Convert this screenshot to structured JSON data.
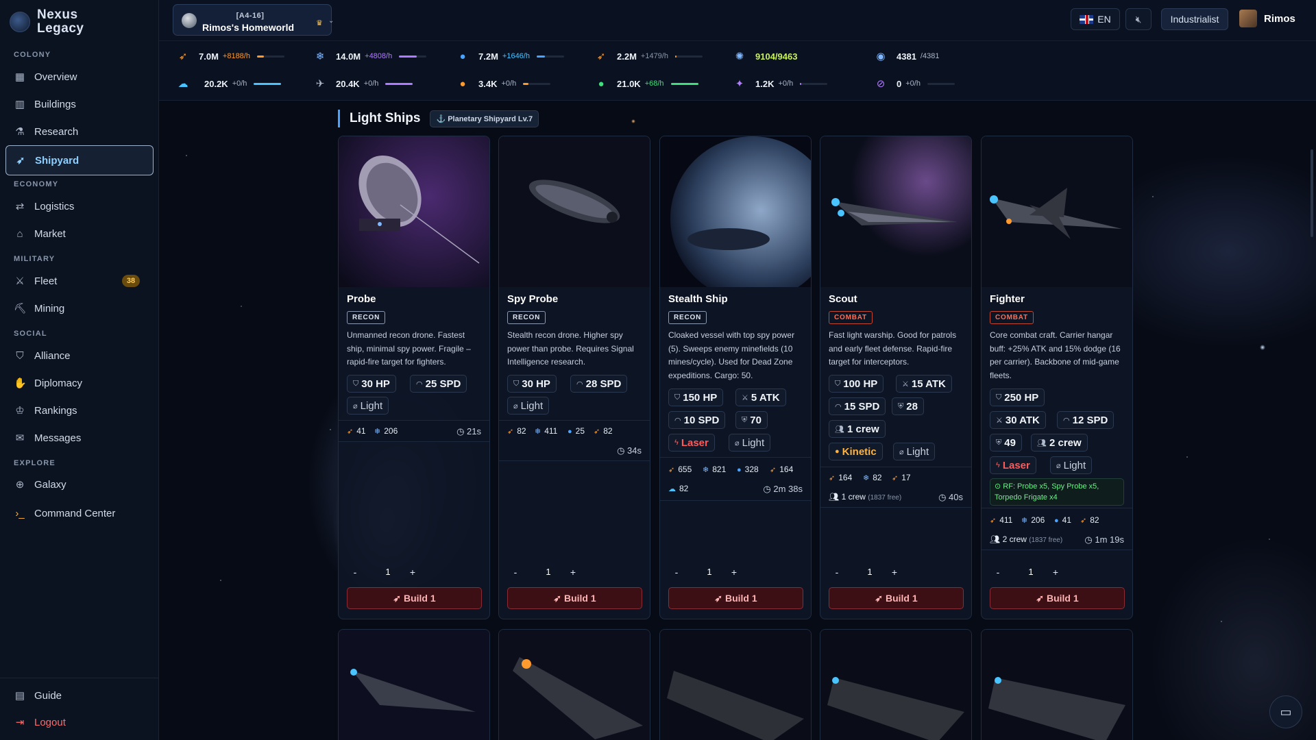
{
  "brand": {
    "name_line1": "Nexus",
    "name_line2": "Legacy"
  },
  "sidebar": {
    "sections": {
      "colony": "COLONY",
      "economy": "ECONOMY",
      "military": "MILITARY",
      "social": "SOCIAL",
      "explore": "EXPLORE"
    },
    "items": {
      "overview": "Overview",
      "buildings": "Buildings",
      "research": "Research",
      "shipyard": "Shipyard",
      "logistics": "Logistics",
      "market": "Market",
      "fleet": "Fleet",
      "fleet_badge": "38",
      "mining": "Mining",
      "alliance": "Alliance",
      "diplomacy": "Diplomacy",
      "rankings": "Rankings",
      "messages": "Messages",
      "galaxy": "Galaxy",
      "command_center": "Command Center"
    },
    "footer": {
      "guide": "Guide",
      "logout": "Logout"
    },
    "active": "Shipyard"
  },
  "header": {
    "planet_coords": "[A4-16]",
    "planet_name": "Rimos's Homeworld",
    "language": "EN",
    "role": "Industrialist",
    "username": "Rimos"
  },
  "resources": {
    "r1": {
      "value": "7.0M",
      "rate": "+8188/h",
      "fill": 0.25,
      "color": "#ff9a2e",
      "icon": "metal-icon"
    },
    "r2": {
      "value": "14.0M",
      "rate": "+4808/h",
      "fill": 0.65,
      "color": "#b07cff",
      "icon": "crystal-icon"
    },
    "r3": {
      "value": "7.2M",
      "rate": "+1646/h",
      "fill": 0.3,
      "color": "#4aa3ff",
      "icon": "deuterium-icon"
    },
    "r4": {
      "value": "2.2M",
      "rate": "+1479/h",
      "fill": 0.05,
      "color": "#ff9a2e",
      "icon": "fuel-icon"
    },
    "r5": {
      "value": "9104/9463",
      "color": "#c9f25c",
      "icon": "energy-icon"
    },
    "r6": {
      "value": "4381",
      "max": "/4381",
      "icon": "population-icon"
    },
    "r7": {
      "value": "20.2K",
      "rate": "+0/h",
      "fill": 1.0,
      "color": "#4ac4ff",
      "icon": "water-icon"
    },
    "r8": {
      "value": "20.4K",
      "rate": "+0/h",
      "fill": 1.0,
      "color": "#b07cff",
      "icon": "alloy-icon"
    },
    "r9": {
      "value": "3.4K",
      "rate": "+0/h",
      "fill": 0.2,
      "color": "#ff9a2e",
      "icon": "food-icon"
    },
    "r10": {
      "value": "21.0K",
      "rate": "+68/h",
      "fill": 1.0,
      "color": "#3ee07a",
      "icon": "bio-icon"
    },
    "r11": {
      "value": "1.2K",
      "rate": "+0/h",
      "fill": 0.05,
      "color": "#b07cff",
      "icon": "dark-matter-icon"
    },
    "r12": {
      "value": "0",
      "rate": "+0/h",
      "fill": 0.0,
      "color": "#b07cff",
      "icon": "antimatter-icon"
    }
  },
  "section": {
    "title": "Light Ships",
    "tag": "Planetary Shipyard Lv.7"
  },
  "ships": [
    {
      "name": "Probe",
      "type": "RECON",
      "desc": "Unmanned recon drone. Fastest ship, minimal spy power. Fragile – rapid-fire target for fighters.",
      "hp": "30 HP",
      "spd": "25 SPD",
      "class": "Light",
      "cost": [
        "41",
        "206"
      ],
      "time": "21s",
      "qty": "1",
      "build": "Build 1"
    },
    {
      "name": "Spy Probe",
      "type": "RECON",
      "desc": "Stealth recon drone. Higher spy power than probe. Requires Signal Intelligence research.",
      "hp": "30 HP",
      "spd": "28 SPD",
      "class": "Light",
      "cost": [
        "82",
        "411",
        "25",
        "82"
      ],
      "time": "34s",
      "qty": "1",
      "build": "Build 1"
    },
    {
      "name": "Stealth Ship",
      "type": "RECON",
      "desc": "Cloaked vessel with top spy power (5). Sweeps enemy minefields (10 mines/cycle). Used for Dead Zone expeditions. Cargo: 50.",
      "hp": "150 HP",
      "atk": "5 ATK",
      "spd": "10 SPD",
      "def": "70",
      "weapon": "Laser",
      "class": "Light",
      "cost": [
        "655",
        "821",
        "328",
        "164",
        "82"
      ],
      "time": "2m 38s",
      "qty": "1",
      "build": "Build 1"
    },
    {
      "name": "Scout",
      "type": "COMBAT",
      "desc": "Fast light warship. Good for patrols and early fleet defense. Rapid-fire target for interceptors.",
      "hp": "100 HP",
      "atk": "15 ATK",
      "spd": "15 SPD",
      "def": "28",
      "crew": "1 crew",
      "weapon": "Kinetic",
      "class": "Light",
      "cost": [
        "164",
        "82",
        "17"
      ],
      "crew_req": "1 crew",
      "crew_free": "(1837 free)",
      "time": "40s",
      "qty": "1",
      "build": "Build 1"
    },
    {
      "name": "Fighter",
      "type": "COMBAT",
      "desc": "Core combat craft. Carrier hangar buff: +25% ATK and 15% dodge (16 per carrier). Backbone of mid-game fleets.",
      "hp": "250 HP",
      "atk": "30 ATK",
      "spd": "12 SPD",
      "def": "49",
      "crew": "2 crew",
      "weapon": "Laser",
      "class": "Light",
      "rf": "RF: Probe x5, Spy Probe x5, Torpedo Frigate x4",
      "cost": [
        "411",
        "206",
        "41",
        "82"
      ],
      "crew_req": "2 crew",
      "crew_free": "(1837 free)",
      "time": "1m 19s",
      "qty": "1",
      "build": "Build 1"
    }
  ],
  "qty_controls": {
    "minus": "-",
    "plus": "+"
  }
}
